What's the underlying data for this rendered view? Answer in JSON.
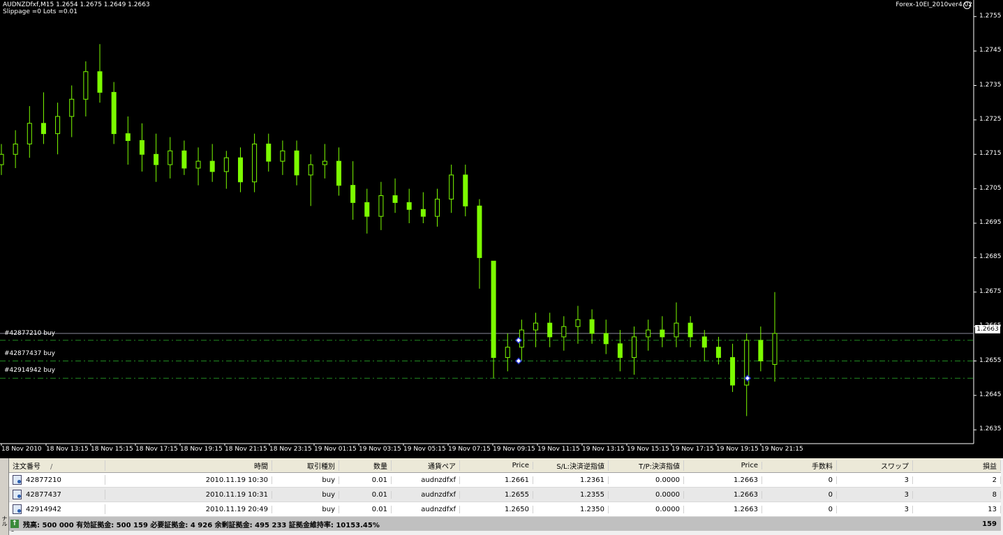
{
  "chart": {
    "symbol_line": "AUDNZDfxf,M15  1.2654 1.2675 1.2649 1.2663",
    "settings_line": "Slippage =0 Lots =0.01",
    "ea_name": "Forex-10EI_2010ver4.02",
    "current_price": "1.2663",
    "orders": [
      {
        "label": "#42877210 buy",
        "price": 1.2661
      },
      {
        "label": "#42877437 buy",
        "price": 1.2655
      },
      {
        "label": "#42914942 buy",
        "price": 1.265
      }
    ]
  },
  "chart_data": {
    "type": "candlestick",
    "ylim": [
      1.2631,
      1.2759
    ],
    "y_ticks": [
      "1.2755",
      "1.2745",
      "1.2735",
      "1.2725",
      "1.2715",
      "1.2705",
      "1.2695",
      "1.2685",
      "1.2675",
      "1.2665",
      "1.2655",
      "1.2645",
      "1.2635"
    ],
    "x_ticks": [
      "18 Nov 2010",
      "18 Nov 13:15",
      "18 Nov 15:15",
      "18 Nov 17:15",
      "18 Nov 19:15",
      "18 Nov 21:15",
      "18 Nov 23:15",
      "19 Nov 01:15",
      "19 Nov 03:15",
      "19 Nov 05:15",
      "19 Nov 07:15",
      "19 Nov 09:15",
      "19 Nov 11:15",
      "19 Nov 13:15",
      "19 Nov 15:15",
      "19 Nov 17:15",
      "19 Nov 19:15",
      "19 Nov 21:15"
    ],
    "candles": [
      {
        "o": 1.2712,
        "h": 1.2718,
        "l": 1.2709,
        "c": 1.2715
      },
      {
        "o": 1.2715,
        "h": 1.2722,
        "l": 1.2711,
        "c": 1.2718
      },
      {
        "o": 1.2718,
        "h": 1.2729,
        "l": 1.2714,
        "c": 1.2724
      },
      {
        "o": 1.2724,
        "h": 1.2733,
        "l": 1.2718,
        "c": 1.2721
      },
      {
        "o": 1.2721,
        "h": 1.273,
        "l": 1.2715,
        "c": 1.2726
      },
      {
        "o": 1.2726,
        "h": 1.2735,
        "l": 1.272,
        "c": 1.2731
      },
      {
        "o": 1.2731,
        "h": 1.2742,
        "l": 1.2726,
        "c": 1.2739
      },
      {
        "o": 1.2739,
        "h": 1.2747,
        "l": 1.273,
        "c": 1.2733
      },
      {
        "o": 1.2733,
        "h": 1.2736,
        "l": 1.2718,
        "c": 1.2721
      },
      {
        "o": 1.2721,
        "h": 1.2726,
        "l": 1.2712,
        "c": 1.2719
      },
      {
        "o": 1.2719,
        "h": 1.2724,
        "l": 1.271,
        "c": 1.2715
      },
      {
        "o": 1.2715,
        "h": 1.2721,
        "l": 1.2707,
        "c": 1.2712
      },
      {
        "o": 1.2712,
        "h": 1.272,
        "l": 1.2708,
        "c": 1.2716
      },
      {
        "o": 1.2716,
        "h": 1.2719,
        "l": 1.2709,
        "c": 1.2711
      },
      {
        "o": 1.2711,
        "h": 1.2717,
        "l": 1.2706,
        "c": 1.2713
      },
      {
        "o": 1.2713,
        "h": 1.2718,
        "l": 1.2707,
        "c": 1.271
      },
      {
        "o": 1.271,
        "h": 1.2716,
        "l": 1.2705,
        "c": 1.2714
      },
      {
        "o": 1.2714,
        "h": 1.2717,
        "l": 1.2704,
        "c": 1.2707
      },
      {
        "o": 1.2707,
        "h": 1.2721,
        "l": 1.2704,
        "c": 1.2718
      },
      {
        "o": 1.2718,
        "h": 1.2721,
        "l": 1.271,
        "c": 1.2713
      },
      {
        "o": 1.2713,
        "h": 1.2719,
        "l": 1.2709,
        "c": 1.2716
      },
      {
        "o": 1.2716,
        "h": 1.2719,
        "l": 1.2706,
        "c": 1.2709
      },
      {
        "o": 1.2709,
        "h": 1.2715,
        "l": 1.27,
        "c": 1.2712
      },
      {
        "o": 1.2712,
        "h": 1.2718,
        "l": 1.2708,
        "c": 1.2713
      },
      {
        "o": 1.2713,
        "h": 1.2717,
        "l": 1.2703,
        "c": 1.2706
      },
      {
        "o": 1.2706,
        "h": 1.2713,
        "l": 1.2696,
        "c": 1.2701
      },
      {
        "o": 1.2701,
        "h": 1.2705,
        "l": 1.2692,
        "c": 1.2697
      },
      {
        "o": 1.2697,
        "h": 1.2707,
        "l": 1.2693,
        "c": 1.2703
      },
      {
        "o": 1.2703,
        "h": 1.2708,
        "l": 1.2698,
        "c": 1.2701
      },
      {
        "o": 1.2701,
        "h": 1.2705,
        "l": 1.2695,
        "c": 1.2699
      },
      {
        "o": 1.2699,
        "h": 1.2704,
        "l": 1.2695,
        "c": 1.2697
      },
      {
        "o": 1.2697,
        "h": 1.2705,
        "l": 1.2694,
        "c": 1.2702
      },
      {
        "o": 1.2702,
        "h": 1.2712,
        "l": 1.2698,
        "c": 1.2709
      },
      {
        "o": 1.2709,
        "h": 1.2712,
        "l": 1.2697,
        "c": 1.27
      },
      {
        "o": 1.27,
        "h": 1.2702,
        "l": 1.2676,
        "c": 1.2685
      },
      {
        "o": 1.2684,
        "h": 1.2684,
        "l": 1.265,
        "c": 1.2656
      },
      {
        "o": 1.2656,
        "h": 1.2663,
        "l": 1.2652,
        "c": 1.2659
      },
      {
        "o": 1.2659,
        "h": 1.2667,
        "l": 1.2655,
        "c": 1.2664
      },
      {
        "o": 1.2664,
        "h": 1.2669,
        "l": 1.2659,
        "c": 1.2666
      },
      {
        "o": 1.2666,
        "h": 1.2669,
        "l": 1.2659,
        "c": 1.2662
      },
      {
        "o": 1.2662,
        "h": 1.2668,
        "l": 1.2658,
        "c": 1.2665
      },
      {
        "o": 1.2665,
        "h": 1.2671,
        "l": 1.266,
        "c": 1.2667
      },
      {
        "o": 1.2667,
        "h": 1.267,
        "l": 1.266,
        "c": 1.2663
      },
      {
        "o": 1.2663,
        "h": 1.2667,
        "l": 1.2657,
        "c": 1.266
      },
      {
        "o": 1.266,
        "h": 1.2664,
        "l": 1.2652,
        "c": 1.2656
      },
      {
        "o": 1.2656,
        "h": 1.2665,
        "l": 1.2651,
        "c": 1.2662
      },
      {
        "o": 1.2662,
        "h": 1.2667,
        "l": 1.2658,
        "c": 1.2664
      },
      {
        "o": 1.2664,
        "h": 1.2668,
        "l": 1.2659,
        "c": 1.2662
      },
      {
        "o": 1.2662,
        "h": 1.2672,
        "l": 1.2659,
        "c": 1.2666
      },
      {
        "o": 1.2666,
        "h": 1.2668,
        "l": 1.2659,
        "c": 1.2662
      },
      {
        "o": 1.2662,
        "h": 1.2664,
        "l": 1.2655,
        "c": 1.2659
      },
      {
        "o": 1.2659,
        "h": 1.2662,
        "l": 1.2654,
        "c": 1.2656
      },
      {
        "o": 1.2656,
        "h": 1.266,
        "l": 1.2646,
        "c": 1.2648
      },
      {
        "o": 1.2648,
        "h": 1.2663,
        "l": 1.2639,
        "c": 1.2661
      },
      {
        "o": 1.2661,
        "h": 1.2665,
        "l": 1.2652,
        "c": 1.2655
      },
      {
        "o": 1.2654,
        "h": 1.2675,
        "l": 1.2649,
        "c": 1.2663
      }
    ]
  },
  "terminal": {
    "sidebar_label": "ターミナル",
    "columns": [
      "注文番号",
      "時間",
      "取引種別",
      "数量",
      "通貨ペア",
      "Price",
      "S/L:決済逆指値",
      "T/P:決済指値",
      "Price",
      "手数料",
      "スワップ",
      "損益"
    ],
    "sort_indicator": "/",
    "rows": [
      {
        "ticket": "42877210",
        "time": "2010.11.19 10:30",
        "type": "buy",
        "size": "0.01",
        "symbol": "audnzdfxf",
        "open_price": "1.2661",
        "sl": "1.2361",
        "tp": "0.0000",
        "price": "1.2663",
        "commission": "0",
        "swap": "3",
        "profit": "2"
      },
      {
        "ticket": "42877437",
        "time": "2010.11.19 10:31",
        "type": "buy",
        "size": "0.01",
        "symbol": "audnzdfxf",
        "open_price": "1.2655",
        "sl": "1.2355",
        "tp": "0.0000",
        "price": "1.2663",
        "commission": "0",
        "swap": "3",
        "profit": "8"
      },
      {
        "ticket": "42914942",
        "time": "2010.11.19 20:49",
        "type": "buy",
        "size": "0.01",
        "symbol": "audnzdfxf",
        "open_price": "1.2650",
        "sl": "1.2350",
        "tp": "0.0000",
        "price": "1.2663",
        "commission": "0",
        "swap": "3",
        "profit": "13"
      }
    ],
    "summary": "残高: 500 000  有効証拠金: 500 159  必要証拠金: 4 926  余剰証拠金: 495 233  証拠金維持率: 10153.45%",
    "total_profit": "159"
  },
  "colors": {
    "candle": "#7cfc00",
    "background": "#000000",
    "order_line": "#228b22",
    "axis": "#ffffff"
  }
}
